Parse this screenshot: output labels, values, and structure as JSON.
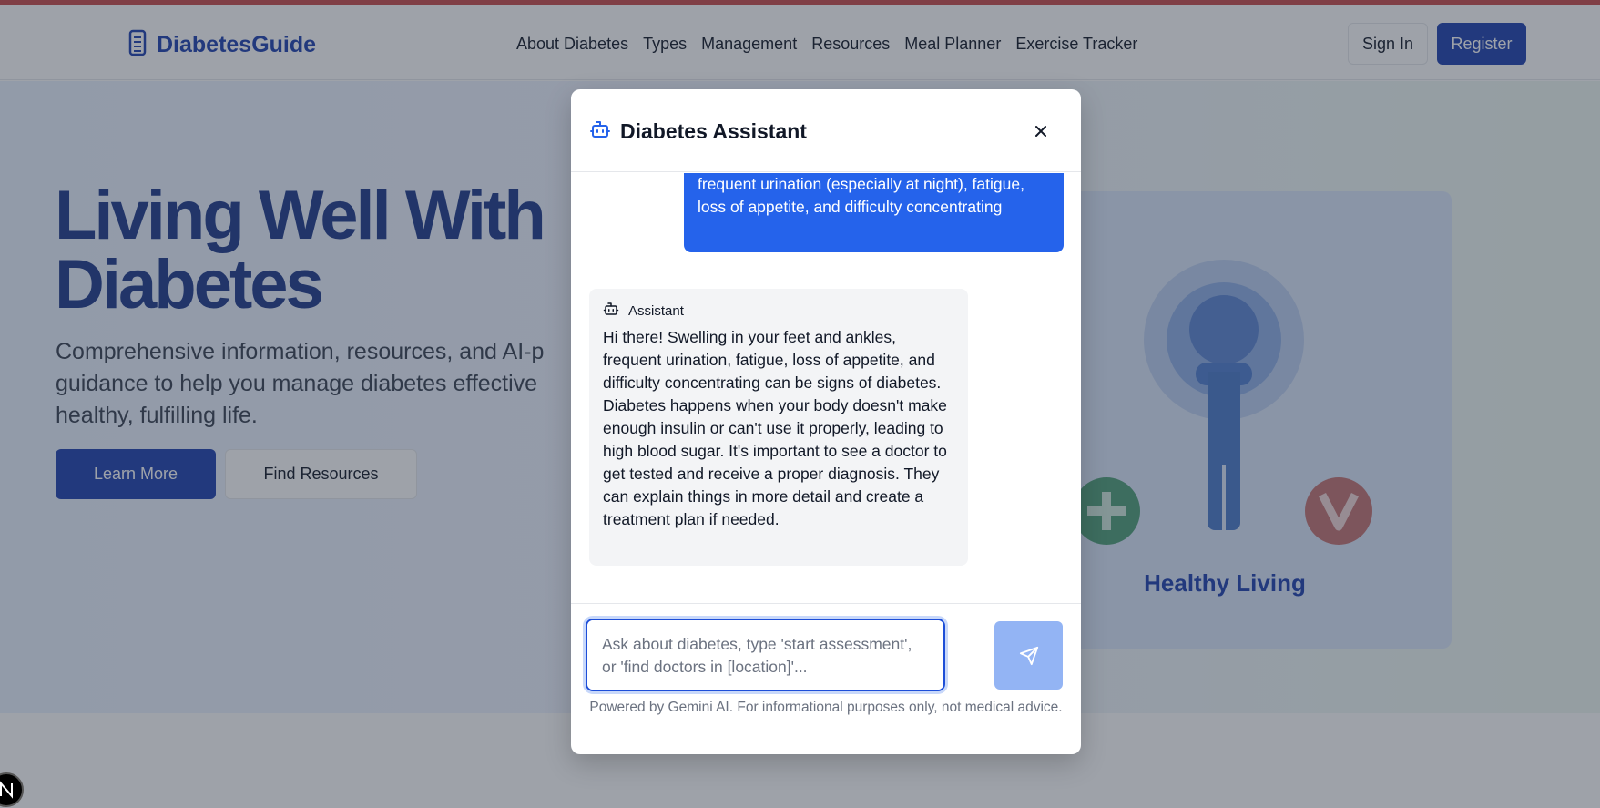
{
  "header": {
    "brand": "DiabetesGuide",
    "nav": [
      "About Diabetes",
      "Types",
      "Management",
      "Resources",
      "Meal Planner",
      "Exercise Tracker"
    ],
    "sign_in": "Sign In",
    "register": "Register"
  },
  "hero": {
    "title": "Living Well With Diabetes",
    "subtitle": "Comprehensive information, resources, and AI-p guidance to help you manage diabetes effective healthy, fulfilling life.",
    "learn_more": "Learn More",
    "find_resources": "Find Resources",
    "illustration_caption": "Healthy Living"
  },
  "chat": {
    "title": "Diabetes Assistant",
    "messages": [
      {
        "role": "user",
        "text": "frequent urination (especially at night), fatigue, loss of appetite, and difficulty concentrating"
      },
      {
        "role": "assistant",
        "sender": "Assistant",
        "text": "Hi there!  Swelling in your feet and ankles, frequent urination, fatigue, loss of appetite, and difficulty concentrating can be signs of diabetes.  Diabetes happens when your body doesn't make enough insulin or can't use it properly, leading to high blood sugar.  It's important to see a doctor to get tested and receive a proper diagnosis.  They can explain things in more detail and create a treatment plan if needed."
      }
    ],
    "input_value": "",
    "input_placeholder": "Ask about diabetes, type 'start assessment', or 'find doctors in [location]'...",
    "footer_note": "Powered by Gemini AI. For informational purposes only, not medical advice."
  },
  "icons": {
    "brand": "document-icon",
    "assistant": "robot-icon",
    "close": "close-icon",
    "send": "send-icon",
    "dev_badge": "n-logo-icon"
  },
  "colors": {
    "brand_blue": "#1e40af",
    "user_bubble": "#2563eb",
    "send_disabled": "#93b4f4",
    "top_stripe": "#c94b4b"
  }
}
